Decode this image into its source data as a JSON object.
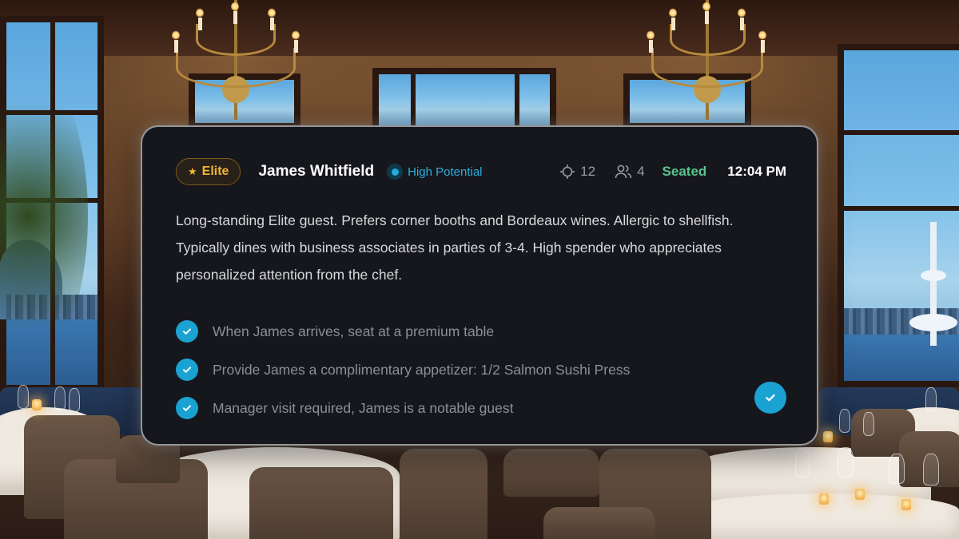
{
  "guest_card": {
    "tier_badge": "Elite",
    "tier_icon": "star-icon",
    "guest_name": "James Whitfield",
    "potential_label": "High Potential",
    "visits_count": "12",
    "party_size": "4",
    "status": "Seated",
    "time": "12:04 PM",
    "notes": "Long-standing Elite guest. Prefers corner booths and Bordeaux wines. Allergic to shellfish. Typically dines with business associates in parties of 3-4. High spender who appreciates personalized attention from the chef.",
    "tasks": [
      {
        "text": "When James arrives, seat at a premium table",
        "checked": true
      },
      {
        "text": "Provide James a complimentary appetizer: 1/2 Salmon Sushi Press",
        "checked": true
      },
      {
        "text": "Manager visit required, James is a notable guest",
        "checked": true
      }
    ],
    "colors": {
      "tier_gold": "#f2b631",
      "potential_blue": "#2bb0e0",
      "seated_green": "#58c58b",
      "check_blue": "#1aa2d3",
      "card_bg": "#16171c"
    }
  }
}
